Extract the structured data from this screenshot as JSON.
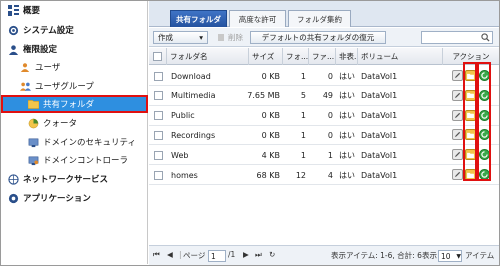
{
  "sidebar": {
    "items": [
      {
        "label": "概要",
        "icon": "overview-icon"
      },
      {
        "label": "システム設定",
        "icon": "gear-icon"
      },
      {
        "label": "権限設定",
        "icon": "user-icon"
      },
      {
        "label": "ユーザ",
        "icon": "user-icon"
      },
      {
        "label": "ユーザグループ",
        "icon": "user-group-icon"
      },
      {
        "label": "共有フォルダ",
        "icon": "folder-icon"
      },
      {
        "label": "クォータ",
        "icon": "quota-icon"
      },
      {
        "label": "ドメインのセキュリティ",
        "icon": "domain-security-icon"
      },
      {
        "label": "ドメインコントローラ",
        "icon": "domain-controller-icon"
      },
      {
        "label": "ネットワークサービス",
        "icon": "network-icon"
      },
      {
        "label": "アプリケーション",
        "icon": "application-icon"
      }
    ]
  },
  "tabs": [
    "共有フォルダ",
    "高度な許可",
    "フォルダ集約"
  ],
  "toolbar": {
    "create": "作成",
    "delete": "削除",
    "restore": "デフォルトの共有フォルダの復元",
    "search_placeholder": ""
  },
  "table": {
    "headers": [
      "フォルダ名",
      "サイズ",
      "フォ...",
      "ファ...",
      "非表...",
      "ボリューム",
      "アクション"
    ],
    "rows": [
      {
        "name": "Download",
        "size": "0 KB",
        "folders": "1",
        "files": "0",
        "hidden": "はい",
        "volume": "DataVol1"
      },
      {
        "name": "Multimedia",
        "size": "7.65 MB",
        "folders": "5",
        "files": "49",
        "hidden": "はい",
        "volume": "DataVol1"
      },
      {
        "name": "Public",
        "size": "0 KB",
        "folders": "1",
        "files": "0",
        "hidden": "はい",
        "volume": "DataVol1"
      },
      {
        "name": "Recordings",
        "size": "0 KB",
        "folders": "1",
        "files": "0",
        "hidden": "はい",
        "volume": "DataVol1"
      },
      {
        "name": "Web",
        "size": "4 KB",
        "folders": "1",
        "files": "1",
        "hidden": "はい",
        "volume": "DataVol1"
      },
      {
        "name": "homes",
        "size": "68 KB",
        "folders": "12",
        "files": "4",
        "hidden": "はい",
        "volume": "DataVol1"
      }
    ]
  },
  "pager": {
    "page_label": "ページ",
    "page_value": "1",
    "of_total": "/1",
    "display_items": "表示アイテム: 1-6, 合計: 6",
    "display_label": "表示",
    "per_page": "10",
    "items_unit": "アイテム"
  },
  "colors": {
    "accent": "#2e8fe0",
    "highlight": "#e01010"
  }
}
